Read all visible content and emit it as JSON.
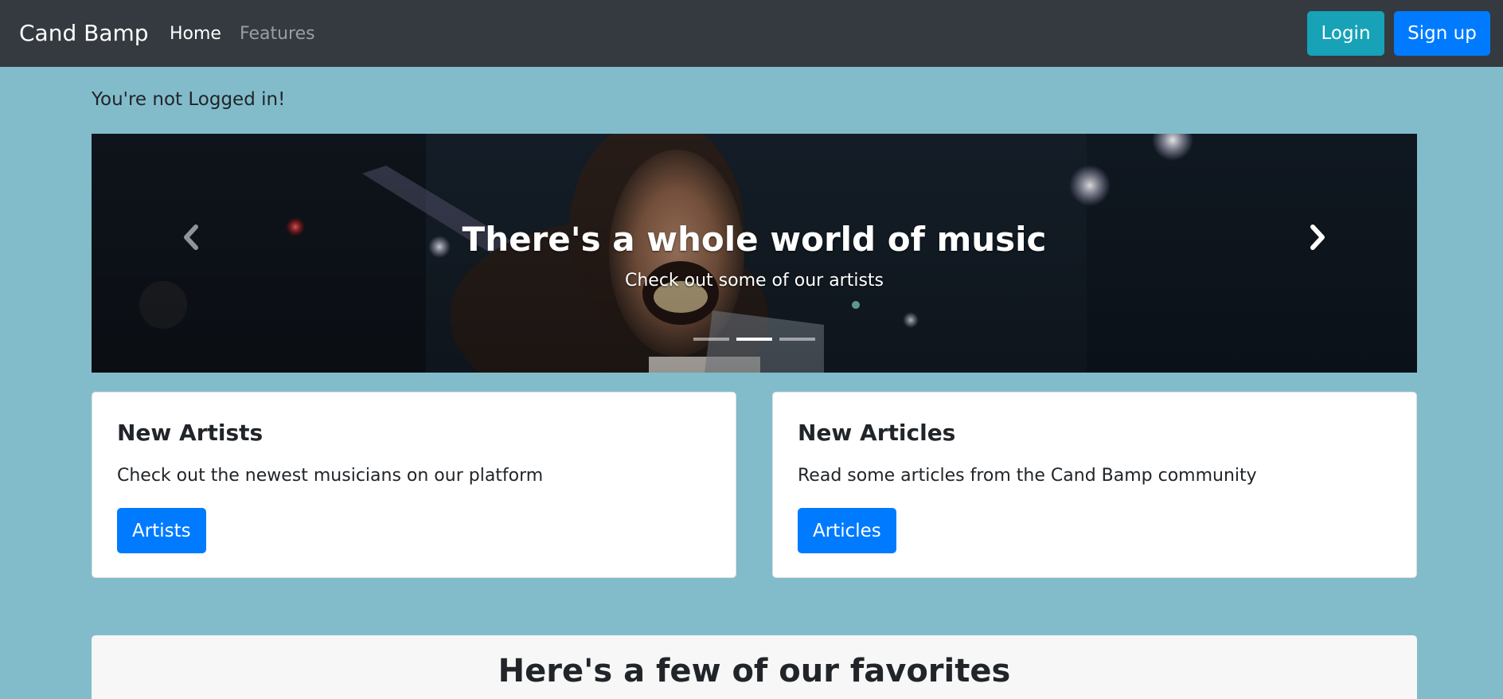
{
  "navbar": {
    "brand": "Cand Bamp",
    "links": [
      {
        "label": "Home"
      },
      {
        "label": "Features"
      }
    ],
    "login_label": "Login",
    "signup_label": "Sign up"
  },
  "status": {
    "text": "You're not Logged in!"
  },
  "carousel": {
    "title": "There's a whole world of music",
    "subtitle": "Check out some of our artists",
    "slide_count": 3,
    "active_slide": 2,
    "prev_icon": "chevron-left-icon",
    "next_icon": "chevron-right-icon"
  },
  "cards": [
    {
      "title": "New Artists",
      "text": "Check out the newest musicians on our platform",
      "button_label": "Artists"
    },
    {
      "title": "New Articles",
      "text": "Read some articles from the Cand Bamp community",
      "button_label": "Articles"
    }
  ],
  "favorites": {
    "title": "Here's a few of our favorites"
  },
  "colors": {
    "page_background": "#82bccb",
    "navbar_background": "#343a40",
    "primary": "#007bff",
    "info": "#17a2b8"
  }
}
